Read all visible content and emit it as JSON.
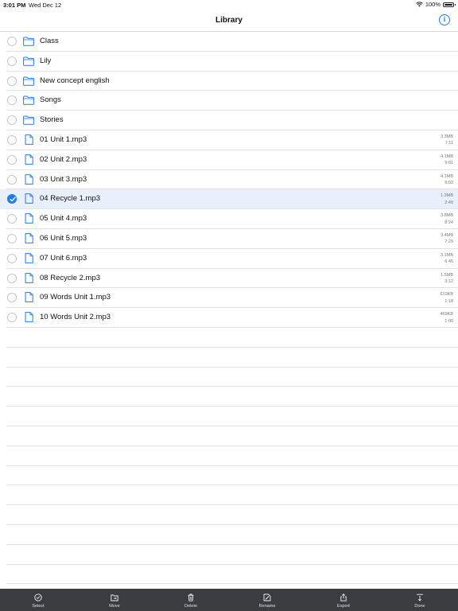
{
  "status_bar": {
    "time": "3:01 PM",
    "date": "Wed Dec 12",
    "battery": "100%"
  },
  "nav": {
    "title": "Library",
    "info_icon": "info-icon"
  },
  "items": [
    {
      "type": "folder",
      "name": "Class",
      "size": "",
      "duration": "",
      "selected": false
    },
    {
      "type": "folder",
      "name": "Lily",
      "size": "",
      "duration": "",
      "selected": false
    },
    {
      "type": "folder",
      "name": "New concept english",
      "size": "",
      "duration": "",
      "selected": false
    },
    {
      "type": "folder",
      "name": "Songs",
      "size": "",
      "duration": "",
      "selected": false
    },
    {
      "type": "folder",
      "name": "Stories",
      "size": "",
      "duration": "",
      "selected": false
    },
    {
      "type": "file",
      "name": "01 Unit 1.mp3",
      "size": "3.3MB",
      "duration": "7:11",
      "selected": false
    },
    {
      "type": "file",
      "name": "02 Unit 2.mp3",
      "size": "4.1MB",
      "duration": "9:01",
      "selected": false
    },
    {
      "type": "file",
      "name": "03 Unit 3.mp3",
      "size": "4.1MB",
      "duration": "9:03",
      "selected": false
    },
    {
      "type": "file",
      "name": "04 Recycle 1.mp3",
      "size": "1.3MB",
      "duration": "2:49",
      "selected": true
    },
    {
      "type": "file",
      "name": "05 Unit 4.mp3",
      "size": "3.8MB",
      "duration": "8:24",
      "selected": false
    },
    {
      "type": "file",
      "name": "06 Unit 5.mp3",
      "size": "3.4MB",
      "duration": "7:29",
      "selected": false
    },
    {
      "type": "file",
      "name": "07 Unit 6.mp3",
      "size": "3.1MB",
      "duration": "6:45",
      "selected": false
    },
    {
      "type": "file",
      "name": "08 Recycle 2.mp3",
      "size": "1.5MB",
      "duration": "3:12",
      "selected": false
    },
    {
      "type": "file",
      "name": "09 Words Unit 1.mp3",
      "size": "610KB",
      "duration": "1:18",
      "selected": false
    },
    {
      "type": "file",
      "name": "10 Words Unit 2.mp3",
      "size": "469KB",
      "duration": "1:00",
      "selected": false
    }
  ],
  "toolbar": [
    {
      "label": "Select",
      "icon": "select-icon"
    },
    {
      "label": "Move",
      "icon": "move-icon"
    },
    {
      "label": "Delete",
      "icon": "trash-icon"
    },
    {
      "label": "Rename",
      "icon": "rename-icon"
    },
    {
      "label": "Export",
      "icon": "export-icon"
    },
    {
      "label": "Done",
      "icon": "done-icon"
    }
  ],
  "colors": {
    "accent": "#1e7cf2",
    "selected_row": "#e8f0fb",
    "toolbar_bg": "#3a3c40"
  }
}
